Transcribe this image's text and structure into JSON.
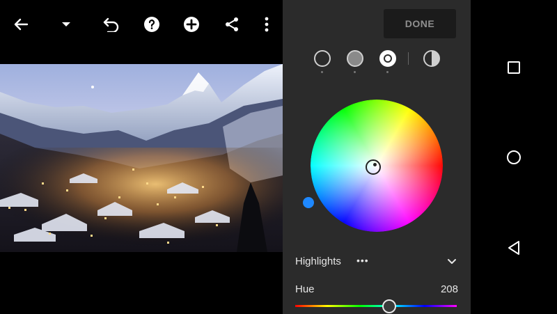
{
  "toolbar": {
    "icons": [
      "back-arrow-icon",
      "dropdown-caret-icon",
      "undo-icon",
      "help-icon",
      "add-icon",
      "share-icon",
      "more-vert-icon"
    ]
  },
  "panel": {
    "done_label": "DONE",
    "modes": [
      "shadows",
      "midtones",
      "highlights",
      "global"
    ],
    "selected_mode": "highlights",
    "selector_label": "Highlights",
    "more_label": "•••",
    "hue_label": "Hue",
    "hue_value": "208",
    "hue_fraction": 0.58,
    "accent_color": "#1e88ff"
  },
  "navbar": {
    "icons": [
      "recents-square-icon",
      "home-circle-icon",
      "back-triangle-icon"
    ]
  }
}
